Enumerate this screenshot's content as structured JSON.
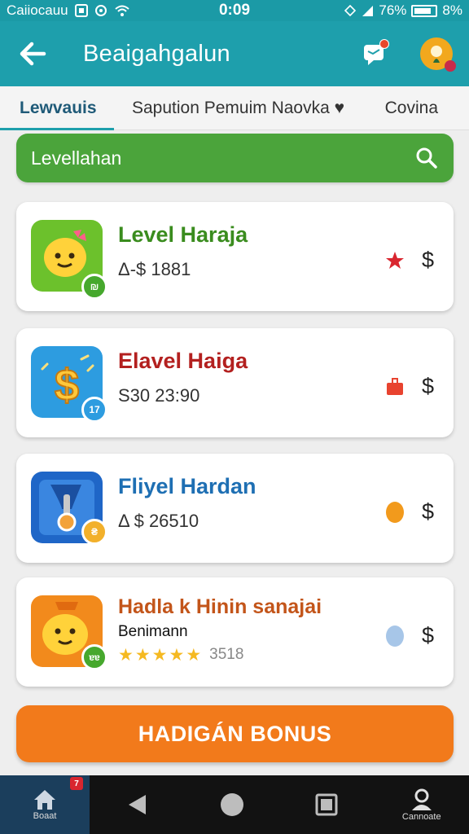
{
  "status_bar": {
    "carrier": "Caiiocauu",
    "time": "0:09",
    "battery": "76%",
    "signal_tail": "8%"
  },
  "app_bar": {
    "title": "Beaigahgalun",
    "back_icon": "arrow-left-icon",
    "notification_icon": "chat-notification-icon",
    "avatar_icon": "user-avatar-icon"
  },
  "tabs": [
    {
      "label": "Lewvauis",
      "active": true
    },
    {
      "label": "Sapution Pemuim Naovka ♥",
      "active": false
    },
    {
      "label": "Covina",
      "active": false
    }
  ],
  "search": {
    "text": "Levellahan",
    "icon": "search-icon"
  },
  "cards": [
    {
      "title": "Level Haraja",
      "subtitle": "Δ-$ 1881",
      "title_color": "#3a8c1e",
      "status_icon": "star-icon",
      "status_color": "#d9262f",
      "price_symbol": "$",
      "badge": "₪"
    },
    {
      "title": "Elavel Haiga",
      "subtitle": "S30 23:90",
      "title_color": "#b3201f",
      "status_icon": "bag-icon",
      "status_color": "#e8432f",
      "price_symbol": "$",
      "badge": "17"
    },
    {
      "title": "Fliyel Hardan",
      "subtitle": "Δ $ 26510",
      "title_color": "#1e6fb3",
      "status_icon": "coin-icon",
      "status_color": "#f29a1c",
      "price_symbol": "$",
      "badge": "₴"
    },
    {
      "title": "Hadla k Hinin sanajai",
      "subtitle": "Benimann",
      "title_color": "#c3551a",
      "status_icon": "drop-icon",
      "status_color": "#a7c6e8",
      "price_symbol": "$",
      "badge": "ɐɐ",
      "rating": 5,
      "rating_count": "3518"
    }
  ],
  "bonus_button": {
    "label": "HADIGÁN BONUS"
  },
  "nav": {
    "home_label": "Boaat",
    "home_badge": "7",
    "profile_label": "Cannoate"
  },
  "colors": {
    "primary": "#1e9fac",
    "search": "#4ba43b",
    "accent": "#f27a1b"
  }
}
